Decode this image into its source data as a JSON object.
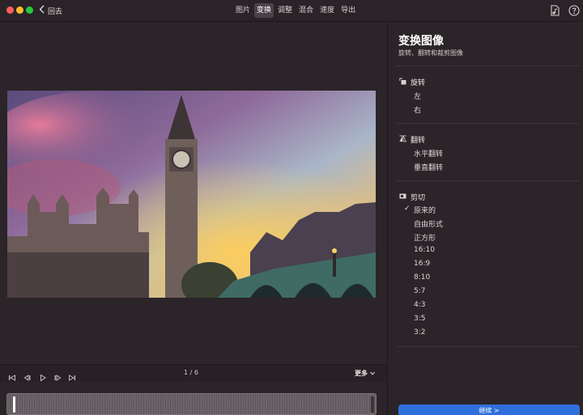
{
  "titlebar": {
    "back_label": "回去",
    "tabs": [
      {
        "label": "图片",
        "active": false
      },
      {
        "label": "变换",
        "active": true
      },
      {
        "label": "调整",
        "active": false
      },
      {
        "label": "混合",
        "active": false
      },
      {
        "label": "速度",
        "active": false
      },
      {
        "label": "导出",
        "active": false
      }
    ]
  },
  "playback": {
    "pager": "1 / 6",
    "more_label": "更多"
  },
  "sidebar": {
    "title": "变换图像",
    "subtitle": "旋转、翻转和裁剪图像",
    "rotate": {
      "heading": "旋转",
      "options": [
        "左",
        "右"
      ]
    },
    "flip": {
      "heading": "翻转",
      "options": [
        "水平翻转",
        "垂直翻转"
      ]
    },
    "crop": {
      "heading": "剪切",
      "selected_mark": "✓",
      "options": [
        "原来的",
        "自由形式",
        "正方形",
        "16:10",
        "16:9",
        "8:10",
        "5:7",
        "4:3",
        "3:5",
        "3:2"
      ]
    },
    "continue_label": "继续 >"
  },
  "colors": {
    "accent": "#2f6fdc",
    "background": "#2b2428"
  }
}
